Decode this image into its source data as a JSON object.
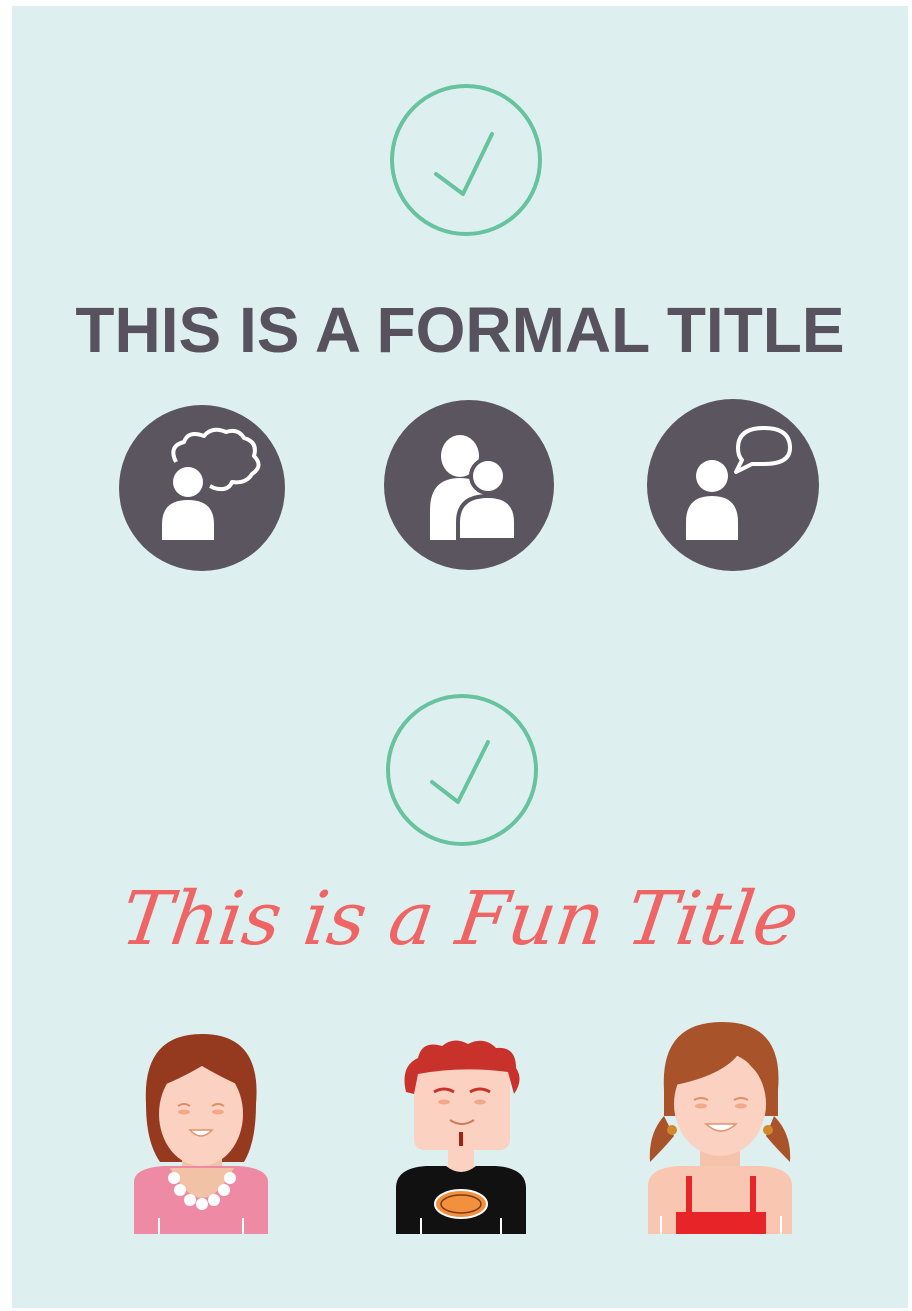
{
  "formal_section": {
    "title": "THIS IS A FORMAL TITLE",
    "icons": [
      "thinking-person-icon",
      "group-people-icon",
      "speaking-person-icon"
    ]
  },
  "fun_section": {
    "title": "This is a Fun Title",
    "avatars": [
      "girl-pink-dress-avatar",
      "boy-red-hair-avatar",
      "girl-pigtails-avatar"
    ]
  },
  "colors": {
    "background": "#ddf0ef",
    "check_green": "#67c39e",
    "formal_text": "#57525e",
    "fun_text": "#ef6566",
    "icon_circle": "#5b5560"
  }
}
